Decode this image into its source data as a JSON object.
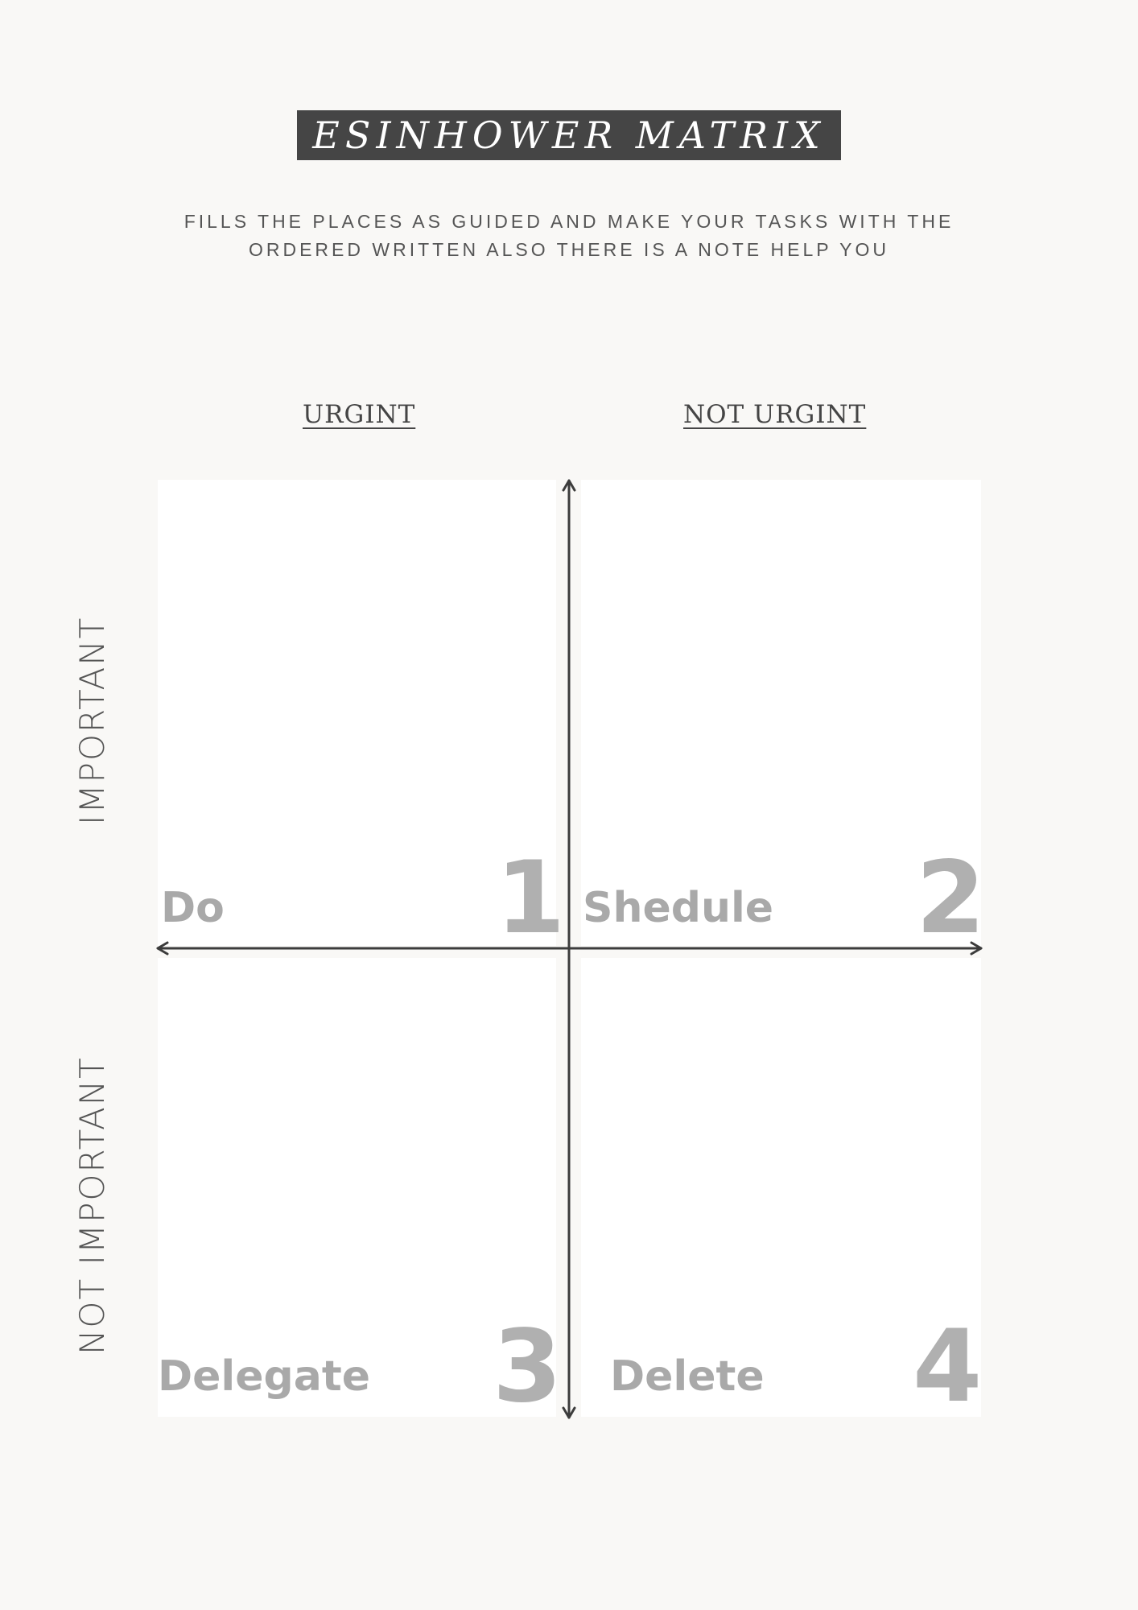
{
  "title": "ESINHOWER MATRIX",
  "subtitle_lines": [
    "FILLS THE PLACES AS GUIDED AND MAKE YOUR TASKS WITH THE",
    "ORDERED WRITTEN ALSO THERE IS A NOTE HELP YOU"
  ],
  "columns": {
    "urgent": "URGINT",
    "not_urgent": "NOT URGINT"
  },
  "rows": {
    "important": "IMPORTANT",
    "not_important": "NOT IMPORTANT"
  },
  "quadrants": [
    {
      "label": "Do",
      "number": "1"
    },
    {
      "label": "Shedule",
      "number": "2"
    },
    {
      "label": "Delegate",
      "number": "3"
    },
    {
      "label": "Delete",
      "number": "4"
    }
  ],
  "colors": {
    "background": "#f9f8f6",
    "title_box": "#454545",
    "axis_line": "#3c3c3c",
    "quadrant_text": "#a9a9a9"
  }
}
